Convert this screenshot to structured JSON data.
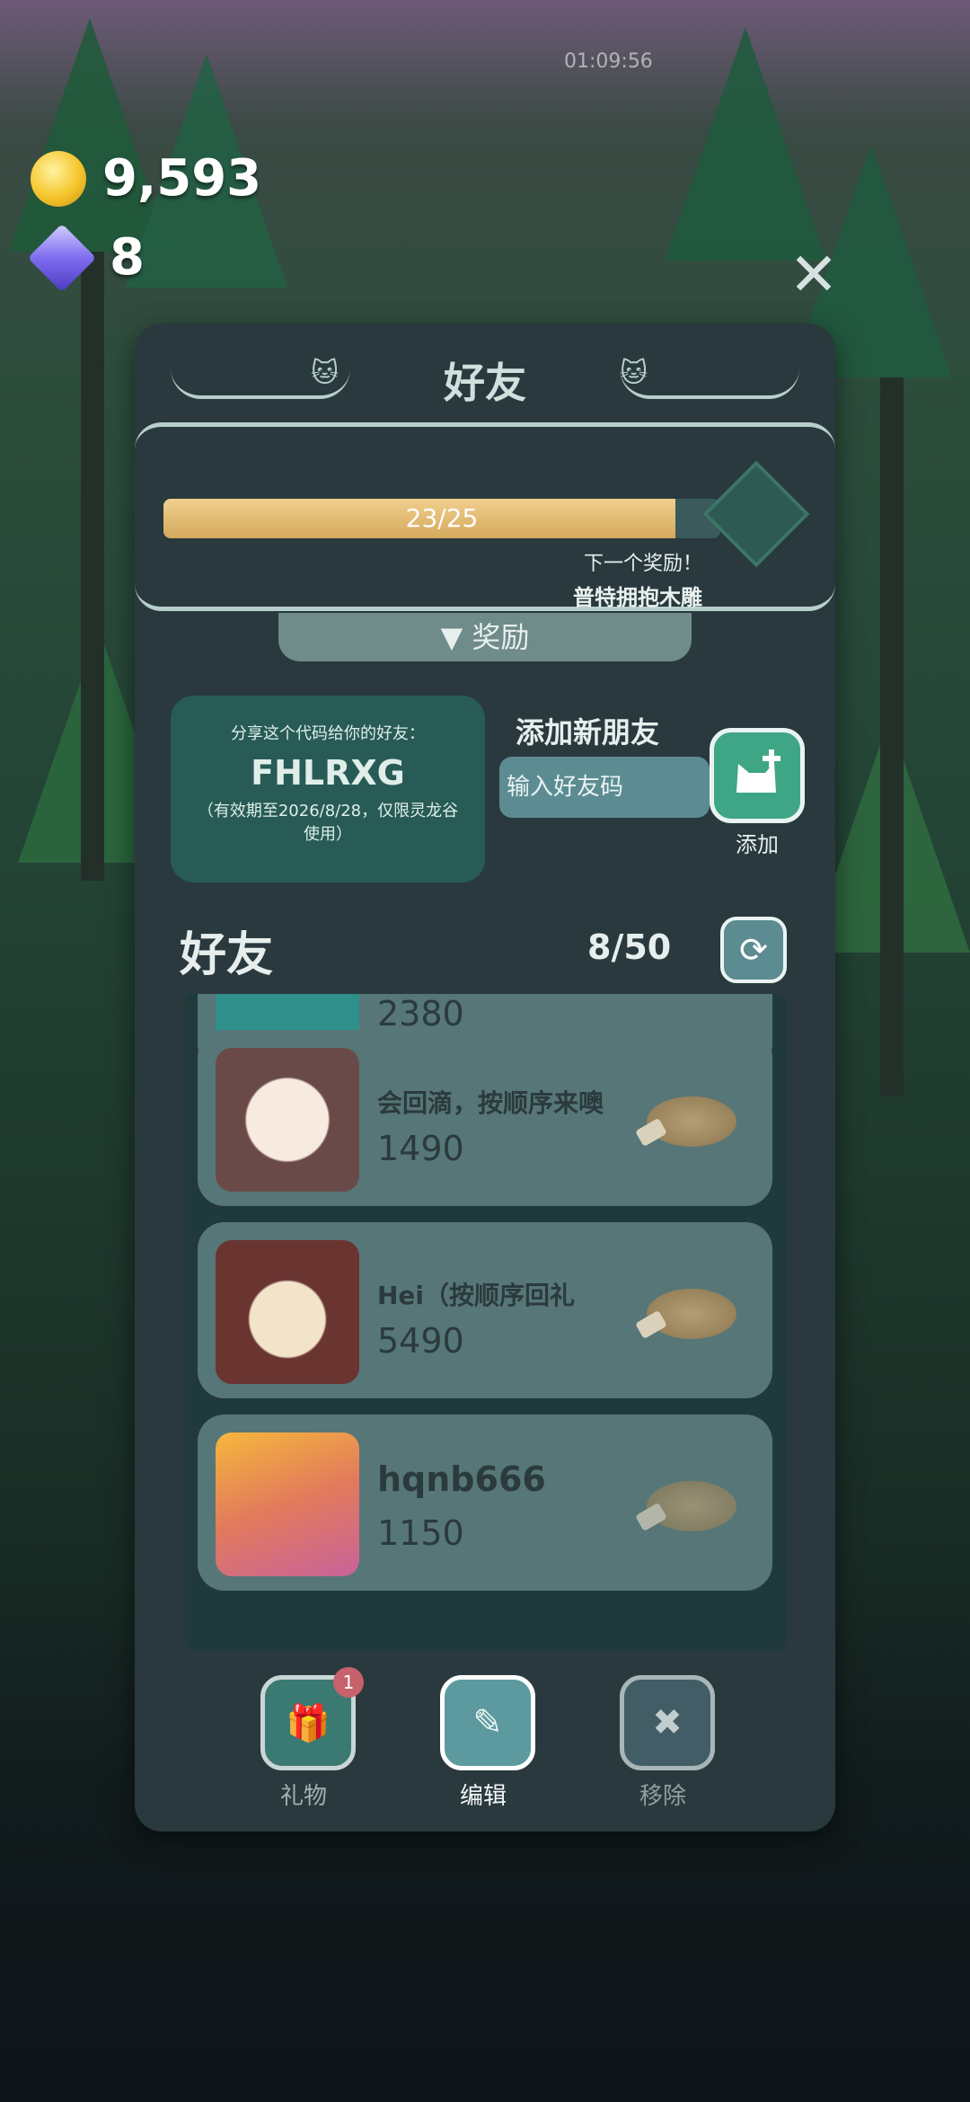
{
  "hud": {
    "coins": "9,593",
    "gems": "8",
    "clock": "01:09:56"
  },
  "panel": {
    "title": "好友",
    "progress": {
      "text": "23/25",
      "fraction": 0.92
    },
    "next_reward_label": "下一个奖励！",
    "next_reward_name": "普特拥抱木雕",
    "reward_tab": "奖励"
  },
  "share": {
    "hint": "分享这个代码给你的好友：",
    "code": "FHLRXG",
    "note": "（有效期至2026/8/28，仅限灵龙谷使用）"
  },
  "add_friend": {
    "title": "添加新朋友",
    "placeholder": "输入好友码",
    "button_label": "添加"
  },
  "friends": {
    "header": "好友",
    "count": "8/50",
    "items": [
      {
        "name": "",
        "score": "2380"
      },
      {
        "name": "会回滴，按顺序来噢",
        "score": "1490"
      },
      {
        "name": "Hei（按顺序回礼",
        "score": "5490"
      },
      {
        "name": "hqnb666",
        "score": "1150"
      }
    ]
  },
  "bottom": {
    "gift_label": "礼物",
    "gift_badge": "1",
    "edit_label": "编辑",
    "remove_label": "移除"
  },
  "colors": {
    "panel_bg": "#29393e",
    "progress_fill": "#d5a95c",
    "card_bg": "#567678",
    "accent_green": "#3fa685"
  }
}
